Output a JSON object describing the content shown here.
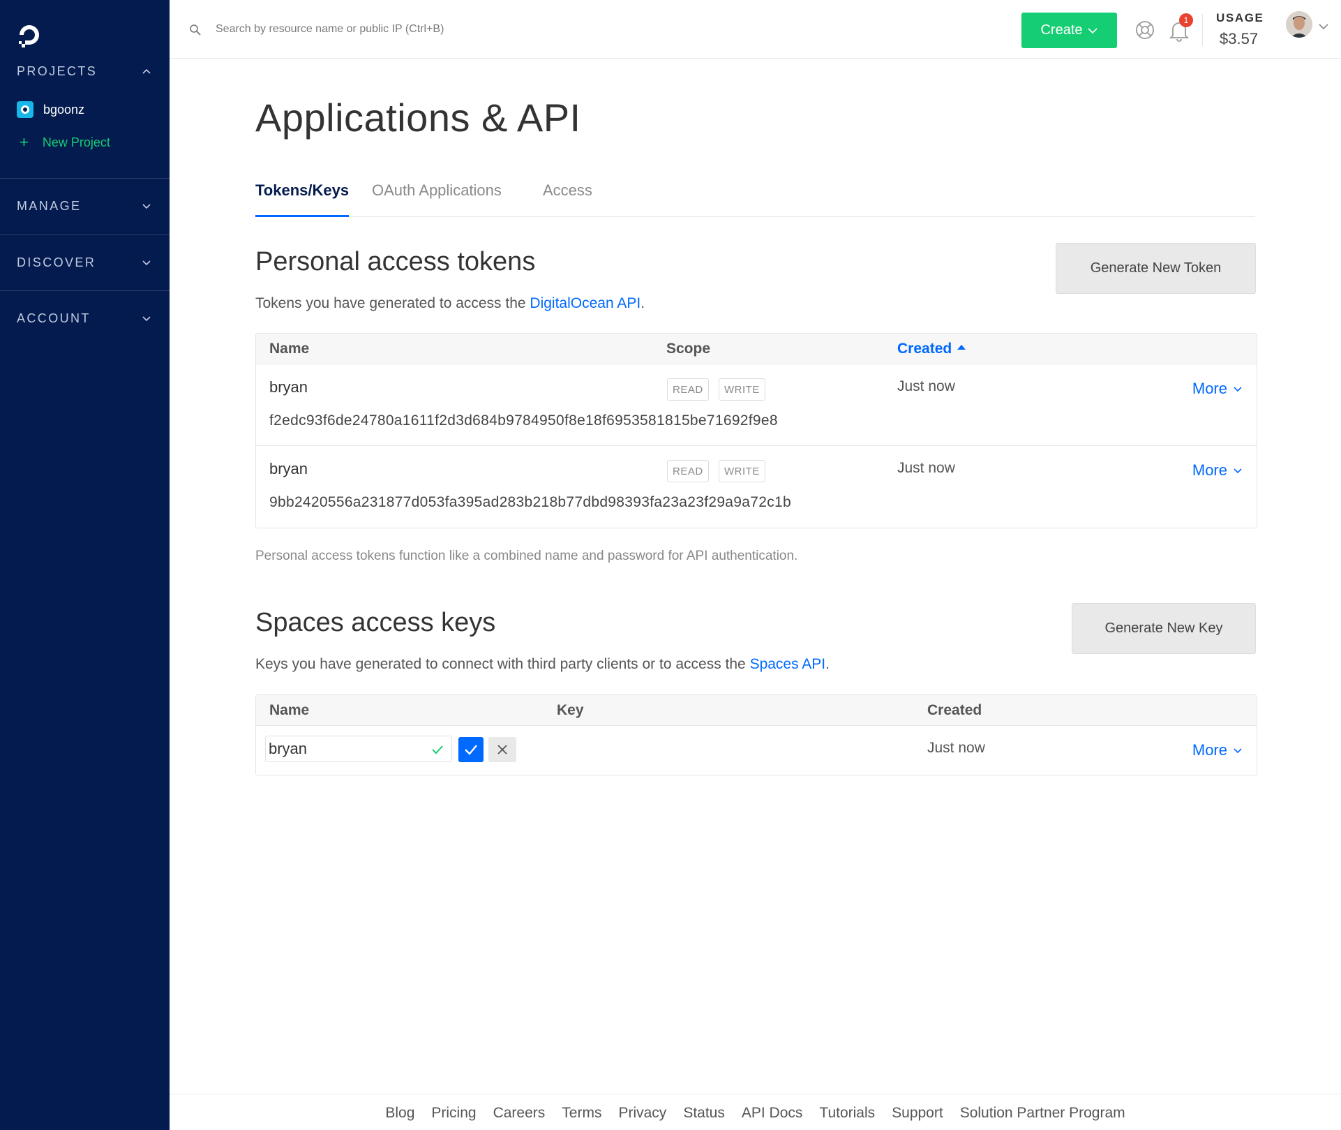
{
  "sidebar": {
    "sections": [
      {
        "label": "PROJECTS"
      },
      {
        "label": "MANAGE"
      },
      {
        "label": "DISCOVER"
      },
      {
        "label": "ACCOUNT"
      }
    ],
    "project": {
      "label": "bgoonz"
    },
    "new_project": {
      "plus": "+",
      "label": "New Project"
    }
  },
  "topbar": {
    "search": {
      "placeholder": "Search by resource name or public IP (Ctrl+B)",
      "value": ""
    },
    "create_label": "Create",
    "notifications_count": "1",
    "usage_label": "USAGE",
    "usage_value": "$3.57"
  },
  "main": {
    "title": "Applications & API",
    "tabs": [
      {
        "label": "Tokens/Keys",
        "active": true
      },
      {
        "label": "OAuth Applications",
        "active": false
      },
      {
        "label": "Access",
        "active": false
      }
    ],
    "tokens": {
      "title": "Personal access tokens",
      "desc_prefix": "Tokens you have generated to access the ",
      "desc_link": "DigitalOcean API",
      "desc_suffix": ".",
      "button": "Generate New Token",
      "headers": {
        "name": "Name",
        "scope": "Scope",
        "created": "Created"
      },
      "rows": [
        {
          "name": "bryan",
          "scopes": [
            "READ",
            "WRITE"
          ],
          "created": "Just now",
          "more": "More",
          "token": "f2edc93f6de24780a1611f2d3d684b9784950f8e18f6953581815be71692f9e8"
        },
        {
          "name": "bryan",
          "scopes": [
            "READ",
            "WRITE"
          ],
          "created": "Just now",
          "more": "More",
          "token": "9bb2420556a231877d053fa395ad283b218b77dbd98393fa23a23f29a9a72c1b"
        }
      ],
      "footnote": "Personal access tokens function like a combined name and password for API authentication."
    },
    "spaces": {
      "title": "Spaces access keys",
      "desc_prefix": "Keys you have generated to connect with third party clients or to access the ",
      "desc_link": "Spaces API",
      "desc_suffix": ".",
      "button": "Generate New Key",
      "headers": {
        "name": "Name",
        "key": "Key",
        "created": "Created"
      },
      "rows": [
        {
          "name_value": "bryan",
          "created": "Just now",
          "more": "More"
        }
      ]
    }
  },
  "footer": {
    "links": [
      "Blog",
      "Pricing",
      "Careers",
      "Terms",
      "Privacy",
      "Status",
      "API Docs",
      "Tutorials",
      "Support",
      "Solution Partner Program"
    ]
  },
  "colors": {
    "sidebar_bg": "#031b4e",
    "accent_green": "#15cd72",
    "link_blue": "#0069ff",
    "badge_red": "#e8432e"
  },
  "icons": [
    "do-logo-icon",
    "chevron-up-icon",
    "chevron-down-icon",
    "plus-icon",
    "search-icon",
    "help-icon",
    "bell-icon",
    "avatar",
    "sort-asc-icon",
    "check-icon",
    "close-icon"
  ]
}
